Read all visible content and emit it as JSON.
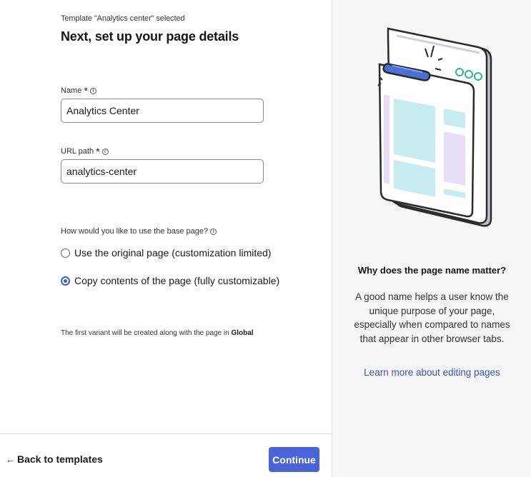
{
  "header": {
    "template_note": "Template \"Analytics center\" selected",
    "title": "Next, set up your page details"
  },
  "form": {
    "name_label": "Name",
    "name_value": "Analytics Center",
    "url_label": "URL path",
    "url_value": "analytics-center",
    "required_mark": "*",
    "info_glyph": "i",
    "question": "How would you like to use the base page?",
    "options": [
      {
        "label": "Use the original page (customization limited)",
        "checked": false
      },
      {
        "label": "Copy contents of the page (fully customizable)",
        "checked": true
      }
    ],
    "variant_note_prefix": "The first variant will be created along with the page in",
    "variant_note_location": "Global"
  },
  "footer": {
    "back_label": "Back to templates",
    "back_arrow": "←",
    "continue_label": "Continue"
  },
  "help": {
    "title": "Why does the page name matter?",
    "body": "A good name helps a user know the unique purpose of your page, especially when compared to names that appear in other browser tabs.",
    "link": "Learn more about editing pages"
  },
  "colors": {
    "accent": "#4a63d9",
    "link": "#3b52c4",
    "panel_bg": "#f6f6f7"
  }
}
